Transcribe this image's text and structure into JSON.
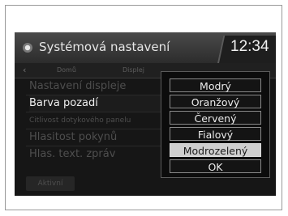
{
  "header": {
    "title": "Systémová nastavení",
    "clock": "12:34",
    "icon": "settings-icon"
  },
  "tabs": {
    "back": "‹",
    "items": [
      "Domů",
      "Displej"
    ]
  },
  "menu": {
    "items": [
      "Nastavení displeje",
      "Barva pozadí",
      "Citlivost dotykového panelu",
      "Hlasitost pokynů",
      "Hlas. text. zpráv"
    ],
    "active_index": 1
  },
  "bottom": {
    "button_label": "Aktivní"
  },
  "popup": {
    "options": [
      "Modrý",
      "Oranžový",
      "Červený",
      "Fialový",
      "Modrozelený",
      "OK"
    ],
    "selected": "Modrozelený"
  },
  "colors": {
    "screen_bg": "#161616",
    "selected_option_bg": "#cfcfcf",
    "text": "#ececec"
  }
}
